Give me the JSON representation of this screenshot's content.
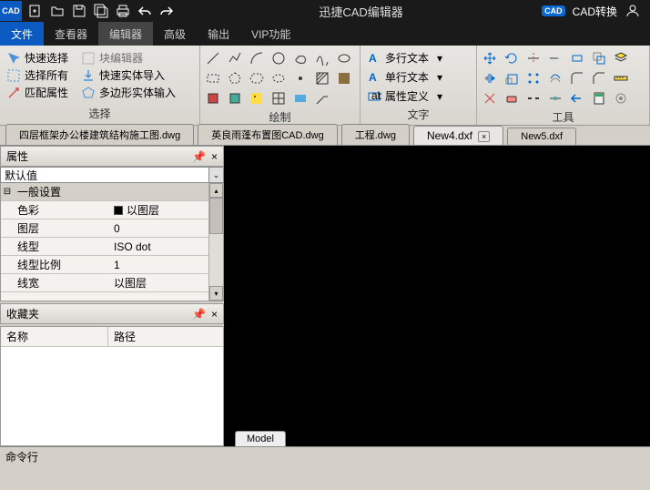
{
  "title": "迅捷CAD编辑器",
  "logo": "CAD",
  "titleRight": {
    "cad": "CAD",
    "convert": "CAD转换"
  },
  "menu": [
    "文件",
    "查看器",
    "编辑器",
    "高级",
    "输出",
    "VIP功能"
  ],
  "menuActive": 0,
  "menuSel": 2,
  "ribbon": {
    "select": {
      "label": "选择",
      "quick": "快速选择",
      "block": "块编辑器",
      "all": "选择所有",
      "import": "快速实体导入",
      "match": "匹配属性",
      "poly": "多边形实体输入"
    },
    "draw": {
      "label": "绘制"
    },
    "text": {
      "label": "文字",
      "multi": "多行文本",
      "single": "单行文本",
      "attr": "属性定义"
    },
    "tools": {
      "label": "工具"
    }
  },
  "tabs": [
    {
      "label": "四层框架办公楼建筑结构施工图.dwg"
    },
    {
      "label": "英良雨蓬布置图CAD.dwg"
    },
    {
      "label": "工程.dwg"
    },
    {
      "label": "New4.dxf",
      "active": true,
      "close": true
    },
    {
      "label": "New5.dxf"
    }
  ],
  "props": {
    "title": "属性",
    "default": "默认值",
    "group": "一般设置",
    "rows": [
      {
        "k": "色彩",
        "v": "以图层",
        "swatch": true
      },
      {
        "k": "图层",
        "v": "0"
      },
      {
        "k": "线型",
        "v": "ISO dot"
      },
      {
        "k": "线型比例",
        "v": "1"
      },
      {
        "k": "线宽",
        "v": "以图层"
      }
    ]
  },
  "fav": {
    "title": "收藏夹",
    "name": "名称",
    "path": "路径"
  },
  "model": "Model",
  "cmd": "命令行"
}
